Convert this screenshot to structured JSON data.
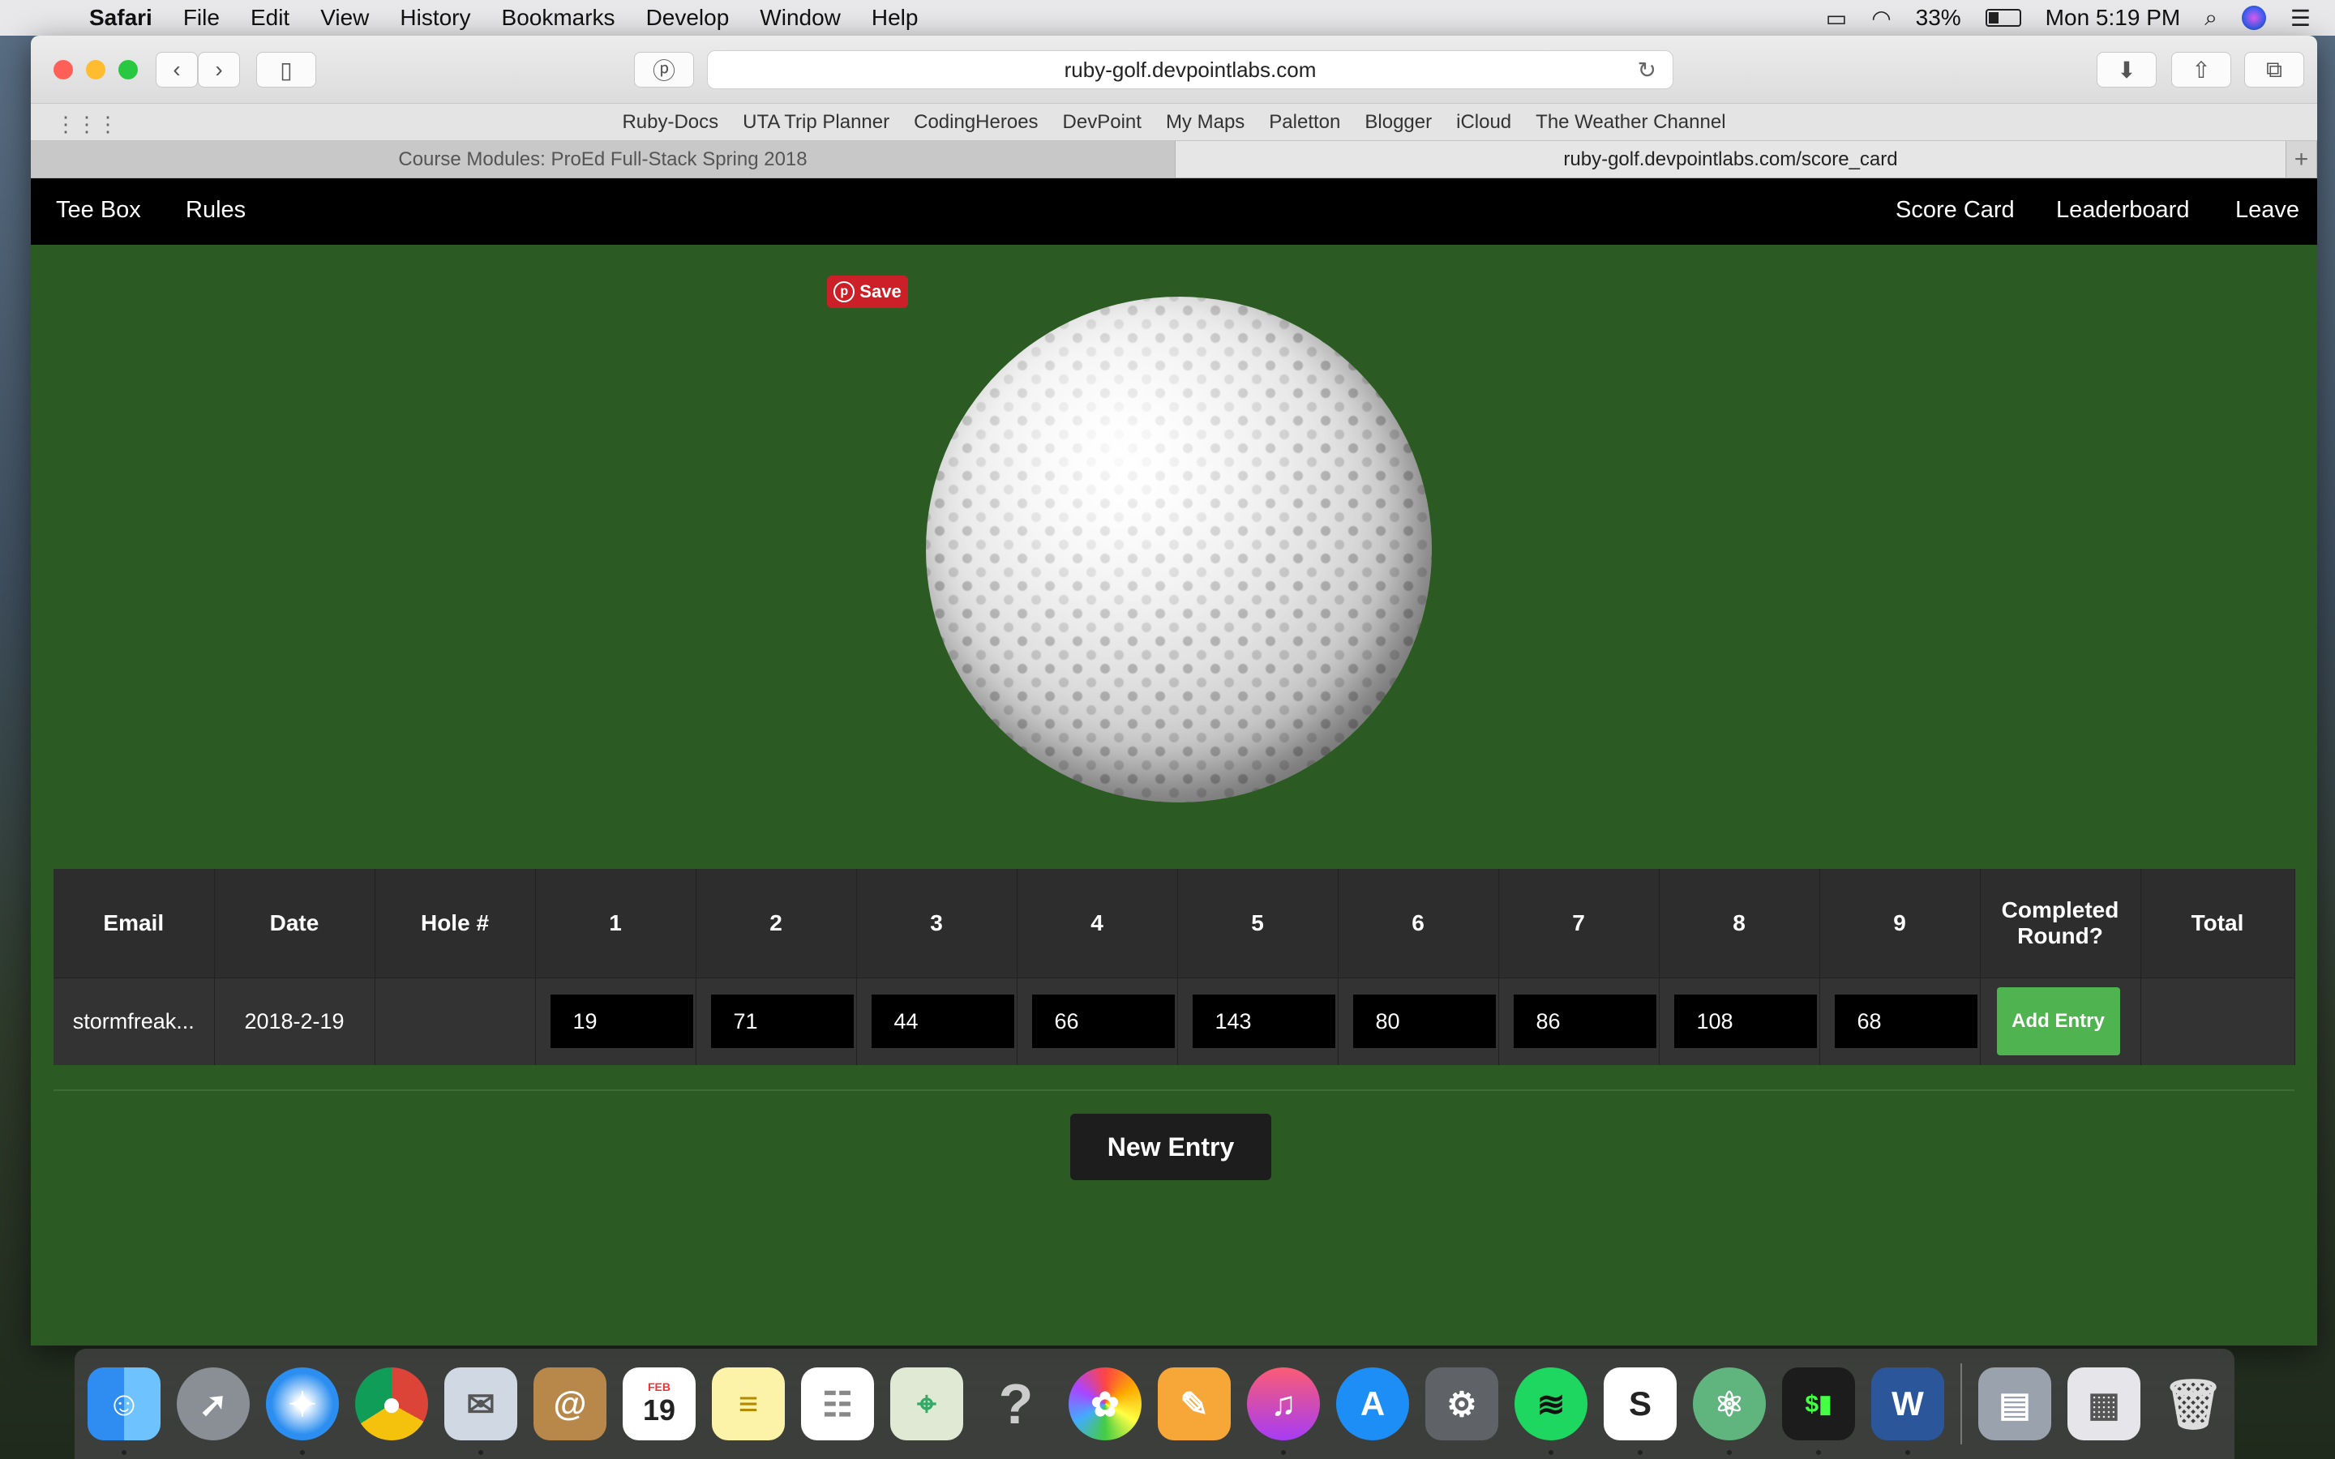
{
  "menubar": {
    "app_name": "Safari",
    "items": [
      "File",
      "Edit",
      "View",
      "History",
      "Bookmarks",
      "Develop",
      "Window",
      "Help"
    ],
    "battery_percent": "33%",
    "clock": "Mon 5:19 PM"
  },
  "browser": {
    "url": "ruby-golf.devpointlabs.com",
    "bookmarks": [
      "Ruby-Docs",
      "UTA Trip Planner",
      "CodingHeroes",
      "DevPoint",
      "My Maps",
      "Paletton",
      "Blogger",
      "iCloud",
      "The Weather Channel"
    ],
    "tabs": [
      {
        "title": "Course Modules: ProEd Full-Stack Spring 2018",
        "active": false
      },
      {
        "title": "ruby-golf.devpointlabs.com/score_card",
        "active": true
      }
    ]
  },
  "nav": {
    "left": [
      "Tee Box",
      "Rules"
    ],
    "right": [
      "Score Card",
      "Leaderboard",
      "Leave"
    ]
  },
  "pinterest": {
    "label": "Save"
  },
  "table": {
    "headers": [
      "Email",
      "Date",
      "Hole #",
      "1",
      "2",
      "3",
      "4",
      "5",
      "6",
      "7",
      "8",
      "9",
      "Completed Round?",
      "Total"
    ],
    "row": {
      "email": "stormfreak...",
      "date": "2018-2-19",
      "hole": "",
      "scores": [
        "19",
        "71",
        "44",
        "66",
        "143",
        "80",
        "86",
        "108",
        "68"
      ],
      "button": "Add Entry",
      "total": ""
    }
  },
  "new_entry_label": "New Entry",
  "dock": {
    "apps": [
      "finder-icon",
      "launchpad-icon",
      "safari-icon",
      "chrome-icon",
      "mail-icon",
      "contacts-icon",
      "calendar-icon",
      "notes-icon",
      "reminders-icon",
      "maps-icon",
      "help-icon",
      "photos-icon",
      "pages-icon",
      "itunes-icon",
      "app-store-icon",
      "system-preferences-icon",
      "spotify-icon",
      "slack-icon",
      "atom-icon",
      "terminal-icon",
      "word-icon"
    ],
    "calendar_month": "FEB",
    "calendar_day": "19"
  }
}
